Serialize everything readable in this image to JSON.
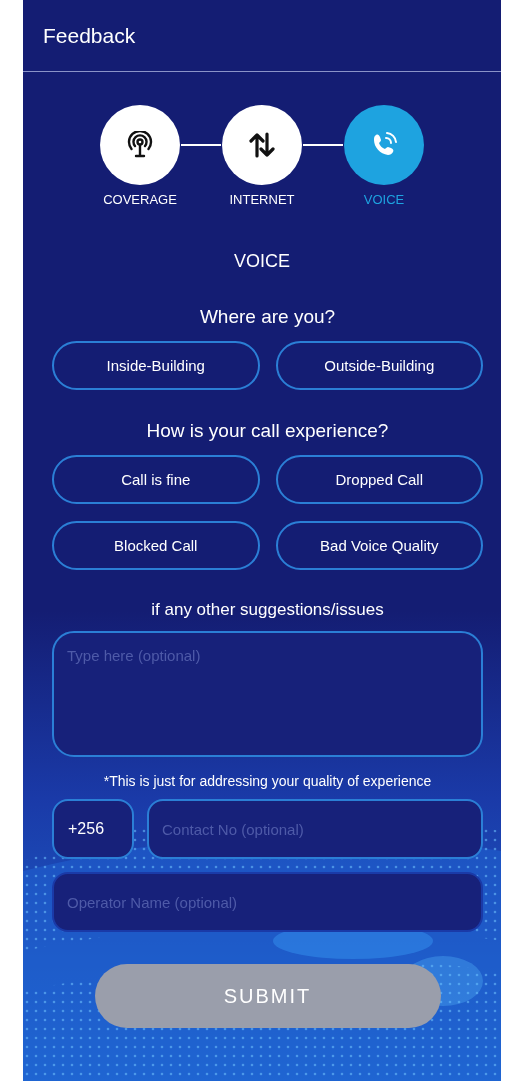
{
  "header": {
    "title": "Feedback"
  },
  "steps": [
    {
      "label": "COVERAGE",
      "kind": "coverage",
      "selected": false
    },
    {
      "label": "INTERNET",
      "kind": "internet",
      "selected": false
    },
    {
      "label": "VOICE",
      "kind": "voice",
      "selected": true
    }
  ],
  "section_title": "VOICE",
  "questions": [
    {
      "prompt": "Where are you?",
      "options": [
        {
          "label": "Inside-Building",
          "selected": false
        },
        {
          "label": "Outside-Building",
          "selected": false
        }
      ]
    },
    {
      "prompt": "How is your call experience?",
      "options": [
        {
          "label": "Call is fine",
          "selected": false
        },
        {
          "label": "Dropped Call",
          "selected": false
        },
        {
          "label": "Blocked Call",
          "selected": false
        },
        {
          "label": "Bad Voice Quality",
          "selected": false
        }
      ]
    }
  ],
  "suggestions": {
    "prompt": "if any other suggestions/issues",
    "placeholder": "Type here (optional)"
  },
  "note": "*This is just for addressing your quality of experience",
  "contact": {
    "country_code": "+256",
    "placeholder": "Contact No (optional)"
  },
  "operator": {
    "placeholder": "Operator Name (optional)"
  },
  "submit": {
    "label": "SUBMIT",
    "disabled": true
  }
}
